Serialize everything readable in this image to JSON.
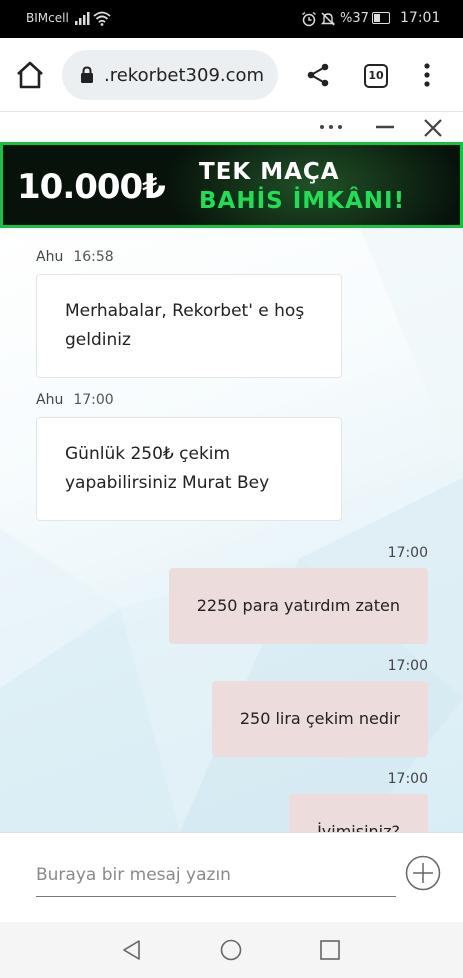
{
  "status_bar": {
    "carrier": "BIMcell",
    "battery_text": "%37",
    "battery_level": 0.37,
    "time": "17:01",
    "icons": [
      "signal-icon",
      "wifi-icon",
      "alarm-icon",
      "mute-icon",
      "battery-icon"
    ]
  },
  "browser": {
    "url": ".rekorbet309.com",
    "tab_count": "10",
    "icons": [
      "home-icon",
      "lock-icon",
      "share-icon",
      "tabs-icon",
      "menu-dots-icon"
    ]
  },
  "widget": {
    "icons": [
      "more-icon",
      "minimize-icon",
      "close-icon"
    ]
  },
  "banner": {
    "amount": "10.000₺",
    "line1": "TEK MAÇA",
    "line2": "BAHİS İMKÂNI!",
    "colors": {
      "accent": "#16c23f",
      "highlight": "#1fe054",
      "background": "#07120b"
    }
  },
  "chat": {
    "incoming": [
      {
        "name": "Ahu",
        "time": "16:58",
        "text": "Merhabalar, Rekorbet' e hoş geldiniz"
      },
      {
        "name": "Ahu",
        "time": "17:00",
        "text": "Günlük 250₺ çekim yapabilirsiniz Murat Bey"
      }
    ],
    "outgoing": [
      {
        "time": "17:00",
        "text": "2250 para yatırdım zaten"
      },
      {
        "time": "17:00",
        "text": "250 lira çekim nedir"
      },
      {
        "time": "17:00",
        "text": "İyimisiniz?"
      }
    ],
    "colors": {
      "outgoing_bubble": "#ecdcdc",
      "incoming_bubble": "#ffffff"
    }
  },
  "composer": {
    "placeholder": "Buraya bir mesaj yazın",
    "value": "",
    "icons": [
      "add-circle-icon"
    ]
  },
  "nav_bar": {
    "icons": [
      "back-icon",
      "home-circle-icon",
      "recents-icon"
    ]
  }
}
